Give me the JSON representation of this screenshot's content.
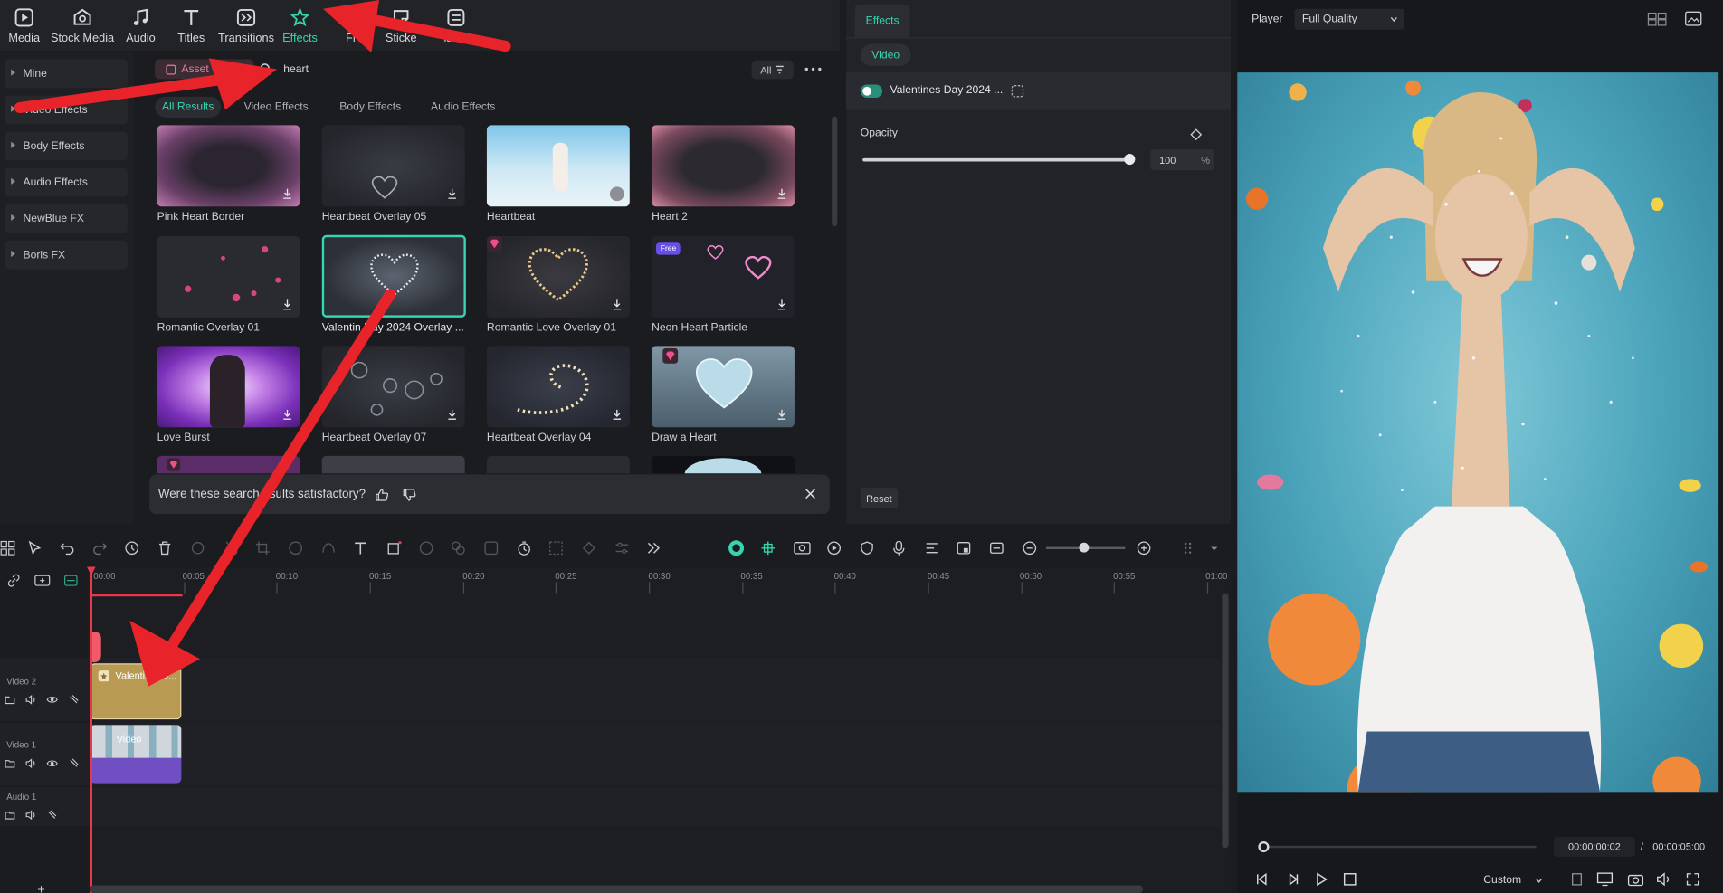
{
  "toolbar": {
    "items": [
      {
        "label": "Media",
        "icon": "media-icon"
      },
      {
        "label": "Stock Media",
        "icon": "stock-media-icon"
      },
      {
        "label": "Audio",
        "icon": "music-note-icon"
      },
      {
        "label": "Titles",
        "icon": "titles-icon"
      },
      {
        "label": "Transitions",
        "icon": "transitions-icon"
      },
      {
        "label": "Effects",
        "icon": "effects-icon"
      },
      {
        "label": "Fi",
        "icon": "filters-icon"
      },
      {
        "label": "Sticke",
        "icon": "stickers-icon"
      },
      {
        "label": "lates",
        "icon": "templates-icon"
      }
    ],
    "active": "Effects",
    "accent": "#36d4b0"
  },
  "categories": [
    "Mine",
    "Video Effects",
    "Body Effects",
    "Audio Effects",
    "NewBlue FX",
    "Boris FX"
  ],
  "browser": {
    "asset_tab": "Asset",
    "search_value": "heart",
    "filter_label": "All",
    "subtabs": [
      "All Results",
      "Video Effects",
      "Body Effects",
      "Audio Effects"
    ],
    "items": [
      {
        "label": "Pink Heart Border"
      },
      {
        "label": "Heartbeat Overlay 05"
      },
      {
        "label": "Heartbeat"
      },
      {
        "label": "Heart 2"
      },
      {
        "label": "Romantic Overlay 01"
      },
      {
        "label": "Valentin  Day 2024 Overlay ..."
      },
      {
        "label": "Romantic Love Overlay 01"
      },
      {
        "label": "Neon Heart Particle"
      },
      {
        "label": "Love Burst"
      },
      {
        "label": "Heartbeat Overlay 07"
      },
      {
        "label": "Heartbeat Overlay 04"
      },
      {
        "label": "Draw a Heart"
      }
    ],
    "free_badge": "Free",
    "feedback": {
      "question": "Were these search  esults satisfactory?"
    }
  },
  "effects_panel": {
    "tab": "Effects",
    "subtab": "Video",
    "effect_name": "Valentines Day 2024 ...",
    "opacity_label": "Opacity",
    "opacity_value": "100",
    "opacity_unit": "%",
    "opacity_level": 1.0,
    "reset_label": "Reset"
  },
  "player": {
    "label": "Player",
    "quality": "Full Quality",
    "current_time": "00:00:00:02",
    "separator": "/",
    "total_time": "00:00:05:00",
    "zoom_mode": "Custom"
  },
  "timeline": {
    "ruler": [
      "00:00",
      "00:05",
      "00:10",
      "00:15",
      "00:20",
      "00:25",
      "00:30",
      "00:35",
      "00:40",
      "00:45",
      "00:50",
      "00:55",
      "01:00"
    ],
    "tracks": [
      "Video 2",
      "Video 1",
      "Audio 1"
    ],
    "effect_clip_label": "Valentin    D...",
    "video_clip_label": "Video",
    "add_symbol": "+"
  }
}
